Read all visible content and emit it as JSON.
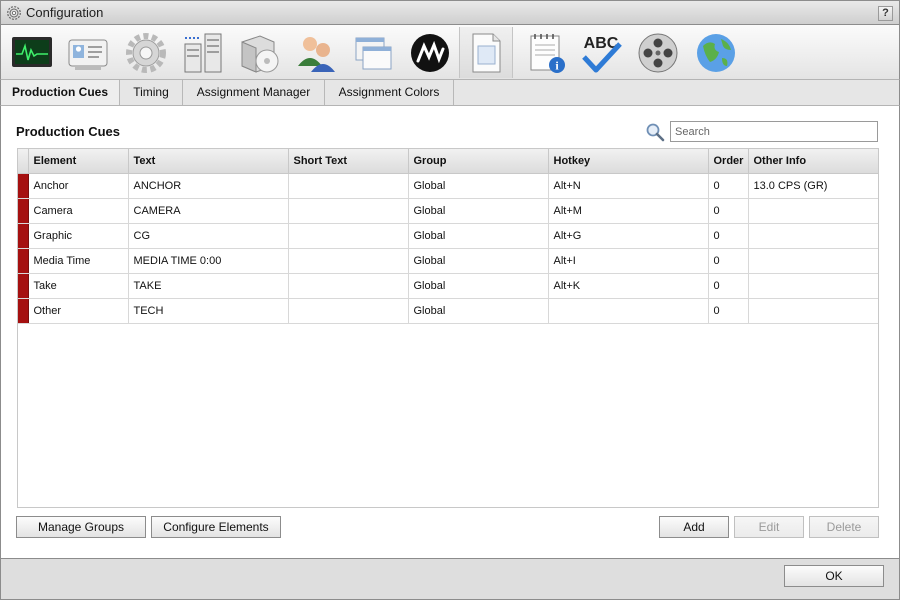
{
  "window": {
    "title": "Configuration",
    "help_label": "?"
  },
  "toolbar": {
    "icons": [
      {
        "name": "monitor-icon"
      },
      {
        "name": "id-card-icon"
      },
      {
        "name": "gear-icon"
      },
      {
        "name": "server-rack-icon"
      },
      {
        "name": "software-box-icon"
      },
      {
        "name": "users-icon"
      },
      {
        "name": "windows-icon"
      },
      {
        "name": "brand-m-icon"
      },
      {
        "name": "document-icon"
      },
      {
        "name": "notepad-info-icon"
      },
      {
        "name": "spellcheck-icon"
      },
      {
        "name": "film-reel-icon"
      },
      {
        "name": "globe-icon"
      }
    ],
    "spellcheck_text": "ABC",
    "active_index": 8
  },
  "tabs": [
    {
      "label": "Production Cues",
      "active": true
    },
    {
      "label": "Timing",
      "active": false
    },
    {
      "label": "Assignment Manager",
      "active": false
    },
    {
      "label": "Assignment Colors",
      "active": false
    }
  ],
  "section": {
    "title": "Production Cues",
    "search_placeholder": "Search"
  },
  "table": {
    "columns": [
      "Element",
      "Text",
      "Short Text",
      "Group",
      "Hotkey",
      "Order",
      "Other Info"
    ],
    "marker_color": "#a51010",
    "rows": [
      {
        "element": "Anchor",
        "text": "ANCHOR",
        "short_text": "",
        "group": "Global",
        "hotkey": "Alt+N",
        "order": "0",
        "other_info": "13.0 CPS (GR)"
      },
      {
        "element": "Camera",
        "text": "CAMERA",
        "short_text": "",
        "group": "Global",
        "hotkey": "Alt+M",
        "order": "0",
        "other_info": ""
      },
      {
        "element": "Graphic",
        "text": "CG",
        "short_text": "",
        "group": "Global",
        "hotkey": "Alt+G",
        "order": "0",
        "other_info": ""
      },
      {
        "element": "Media Time",
        "text": "MEDIA TIME 0:00",
        "short_text": "",
        "group": "Global",
        "hotkey": "Alt+I",
        "order": "0",
        "other_info": ""
      },
      {
        "element": "Take",
        "text": "TAKE",
        "short_text": "",
        "group": "Global",
        "hotkey": "Alt+K",
        "order": "0",
        "other_info": ""
      },
      {
        "element": "Other",
        "text": "TECH",
        "short_text": "",
        "group": "Global",
        "hotkey": "",
        "order": "0",
        "other_info": ""
      }
    ]
  },
  "buttons": {
    "manage_groups": "Manage Groups",
    "configure_elements": "Configure Elements",
    "add": "Add",
    "edit": "Edit",
    "delete": "Delete",
    "ok": "OK"
  }
}
